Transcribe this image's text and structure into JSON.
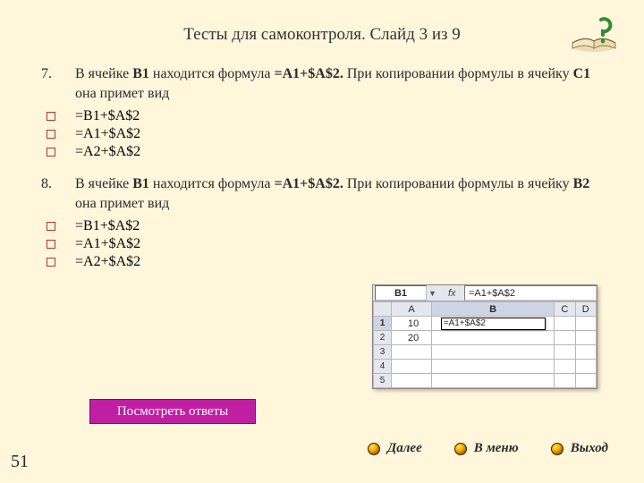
{
  "title": "Тесты для самоконтроля. Слайд 3 из 9",
  "page_number": "51",
  "icon": "book-question",
  "questions": {
    "q7": {
      "num": "7.",
      "pre": "В ячейке ",
      "cell1": "В1",
      "mid1": " находится формула  ",
      "formula": "=A1+$A$2.",
      "mid2": " При копировании формулы в ячейку ",
      "cell2": "С1",
      "post": " она примет вид",
      "opts": [
        "=В1+$A$2",
        "=A1+$A$2",
        "=A2+$A$2"
      ]
    },
    "q8": {
      "num": "8.",
      "pre": "В ячейке ",
      "cell1": "В1",
      "mid1": " находится формула  ",
      "formula": "=A1+$A$2.",
      "mid2": " При копировании формулы в ячейку ",
      "cell2": "В2",
      "post": " она примет вид",
      "opts": [
        "=В1+$A$2",
        "=A1+$A$2",
        "=A2+$A$2"
      ]
    }
  },
  "answers_button": "Посмотреть ответы",
  "nav": {
    "next": "Далее",
    "menu": "В меню",
    "exit": "Выход"
  },
  "sheet": {
    "namebox": "B1",
    "fx": "fx",
    "formula": "=A1+$A$2",
    "cols": [
      "A",
      "B",
      "C",
      "D"
    ],
    "rows": [
      "1",
      "2",
      "3",
      "4",
      "5"
    ],
    "a1": "10",
    "a2": "20",
    "b1_edit": "=A1+$A$2"
  }
}
